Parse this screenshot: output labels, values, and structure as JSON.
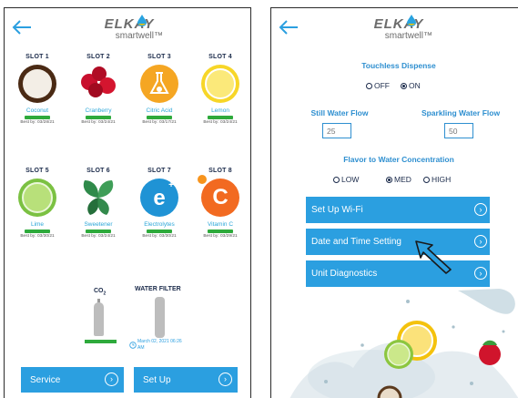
{
  "brand": {
    "name": "ELKAY",
    "product": "smartwell",
    "tm": "™"
  },
  "slots": [
    {
      "title": "SLOT 1",
      "name": "Coconut",
      "best": "Best by: 03/28/21",
      "icon": "coconut-icon"
    },
    {
      "title": "SLOT 2",
      "name": "Cranberry",
      "best": "Best by: 03/24/21",
      "icon": "cranberry-icon"
    },
    {
      "title": "SLOT 3",
      "name": "Citric Acid",
      "best": "Best by: 03/17/21",
      "icon": "flask-icon"
    },
    {
      "title": "SLOT 4",
      "name": "Lemon",
      "best": "Best by: 03/24/21",
      "icon": "lemon-icon"
    },
    {
      "title": "SLOT 5",
      "name": "Lime",
      "best": "Best by: 03/30/21",
      "icon": "lime-icon"
    },
    {
      "title": "SLOT 6",
      "name": "Sweetener",
      "best": "Best by: 03/24/21",
      "icon": "leaf-icon"
    },
    {
      "title": "SLOT 7",
      "name": "Electrolytes",
      "best": "Best by: 03/30/21",
      "icon": "electrolytes-icon"
    },
    {
      "title": "SLOT 8",
      "name": "Vitamin C",
      "best": "Best by: 03/29/21",
      "icon": "vitamin-c-icon"
    }
  ],
  "co2": {
    "label": "CO",
    "sub": "2"
  },
  "filter": {
    "label": "WATER FILTER",
    "date": "March 02, 2021 06:26",
    "ampm": "AM"
  },
  "left_buttons": {
    "service": "Service",
    "setup": "Set Up"
  },
  "dispense": {
    "title": "Touchless Dispense",
    "off": "OFF",
    "on": "ON",
    "selected": "ON"
  },
  "still": {
    "label": "Still Water Flow",
    "value": "25"
  },
  "sparkling": {
    "label": "Sparkling Water Flow",
    "value": "50"
  },
  "concentration": {
    "title": "Flavor to Water Concentration",
    "low": "LOW",
    "med": "MED",
    "high": "HIGH",
    "selected": "MED"
  },
  "menu": {
    "wifi": "Set Up Wi-Fi",
    "datetime": "Date and Time Setting",
    "diagnostics": "Unit Diagnostics"
  },
  "colors": {
    "accent": "#2b9fe0",
    "green": "#2eaa3c",
    "heading": "#2e8fd0"
  }
}
